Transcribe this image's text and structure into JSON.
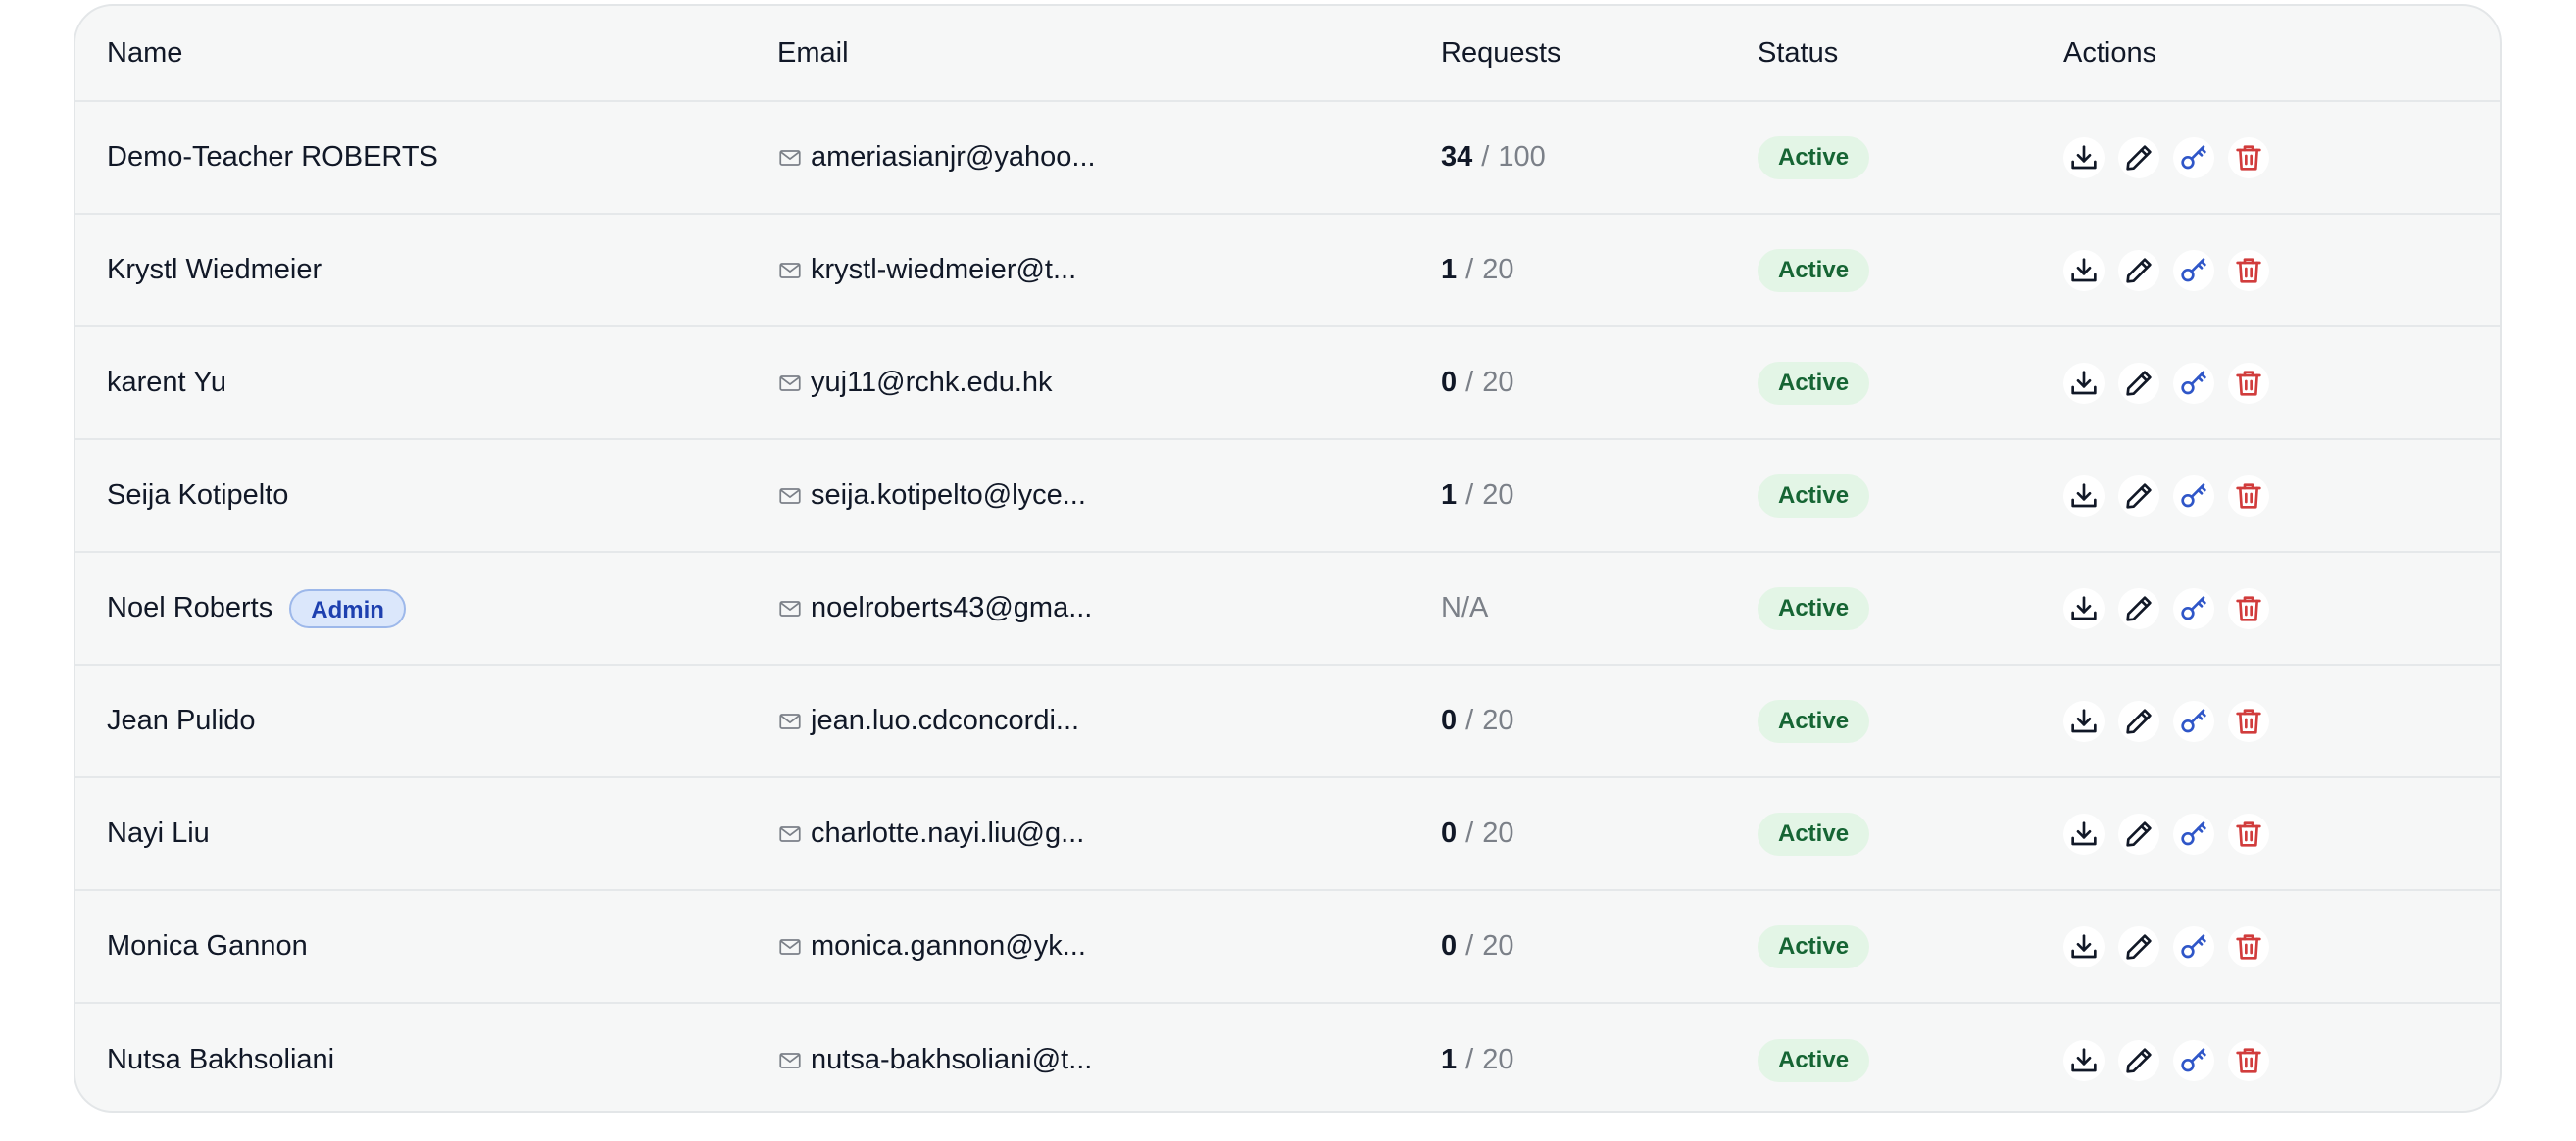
{
  "table": {
    "headers": {
      "name": "Name",
      "email": "Email",
      "requests": "Requests",
      "status": "Status",
      "actions": "Actions"
    },
    "rows": [
      {
        "name": "Demo-Teacher ROBERTS",
        "badge": "",
        "email": "ameriasianjr@yahoo...",
        "used": "34",
        "sep": "/",
        "limit": "100",
        "na": "",
        "status": "Active"
      },
      {
        "name": "Krystl Wiedmeier",
        "badge": "",
        "email": "krystl-wiedmeier@t...",
        "used": "1",
        "sep": "/",
        "limit": "20",
        "na": "",
        "status": "Active"
      },
      {
        "name": "karent Yu",
        "badge": "",
        "email": "yuj11@rchk.edu.hk",
        "used": "0",
        "sep": "/",
        "limit": "20",
        "na": "",
        "status": "Active"
      },
      {
        "name": "Seija Kotipelto",
        "badge": "",
        "email": "seija.kotipelto@lyce...",
        "used": "1",
        "sep": "/",
        "limit": "20",
        "na": "",
        "status": "Active"
      },
      {
        "name": "Noel Roberts",
        "badge": "Admin",
        "email": "noelroberts43@gma...",
        "used": "",
        "sep": "",
        "limit": "",
        "na": "N/A",
        "status": "Active"
      },
      {
        "name": "Jean Pulido",
        "badge": "",
        "email": "jean.luo.cdconcordi...",
        "used": "0",
        "sep": "/",
        "limit": "20",
        "na": "",
        "status": "Active"
      },
      {
        "name": "Nayi Liu",
        "badge": "",
        "email": "charlotte.nayi.liu@g...",
        "used": "0",
        "sep": "/",
        "limit": "20",
        "na": "",
        "status": "Active"
      },
      {
        "name": "Monica Gannon",
        "badge": "",
        "email": "monica.gannon@yk...",
        "used": "0",
        "sep": "/",
        "limit": "20",
        "na": "",
        "status": "Active"
      },
      {
        "name": "Nutsa Bakhsoliani",
        "badge": "",
        "email": "nutsa-bakhsoliani@t...",
        "used": "1",
        "sep": "/",
        "limit": "20",
        "na": "",
        "status": "Active"
      }
    ],
    "icons": {
      "email": "mail-icon",
      "actions": [
        "download-icon",
        "edit-icon",
        "key-icon",
        "trash-icon"
      ]
    },
    "colors": {
      "status_bg": "#e3f5e6",
      "status_text": "#166534",
      "admin_bg": "#dbe7fb",
      "admin_text": "#1e40af",
      "key_icon": "#2f56c8",
      "trash_icon": "#d13c3c"
    }
  }
}
